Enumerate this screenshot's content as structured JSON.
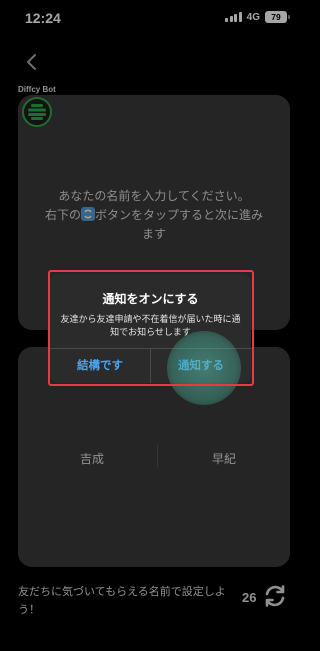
{
  "status_bar": {
    "time": "12:24",
    "network": "4G",
    "battery": "79"
  },
  "bot": {
    "name": "Diffcy Bot"
  },
  "card": {
    "message_line1": "あなたの名前を入力してください。",
    "message_line2_pre": "右下の",
    "message_line2_post": "ボタンをタップすると次に進み",
    "message_line3": "ます"
  },
  "name_options": [
    "吉成",
    "早紀"
  ],
  "footer": {
    "hint": "友だちに気づいてもらえる名前で設定しよう！",
    "counter": "26"
  },
  "dialog": {
    "title": "通知をオンにする",
    "body": "友達から友達申請や不在着信が届いた時に通知でお知らせします",
    "decline_label": "結構です",
    "accept_label": "通知する"
  },
  "colors": {
    "accent": "#4da3f0",
    "highlight_frame": "#e8394a",
    "bot_ring": "#2ea84a"
  }
}
